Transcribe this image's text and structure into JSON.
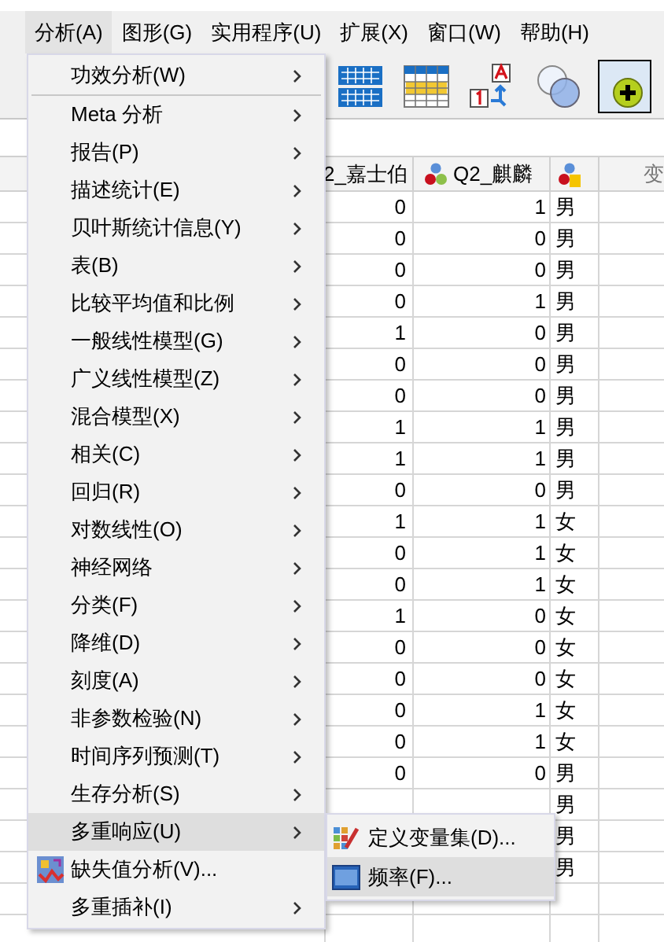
{
  "menubar": [
    {
      "label": "分析(A)",
      "selected": true
    },
    {
      "label": "图形(G)",
      "selected": false
    },
    {
      "label": "实用程序(U)",
      "selected": false
    },
    {
      "label": "扩展(X)",
      "selected": false
    },
    {
      "label": "窗口(W)",
      "selected": false
    },
    {
      "label": "帮助(H)",
      "selected": false
    }
  ],
  "toolbar": [
    {
      "kind": "grid",
      "on": false
    },
    {
      "kind": "grid-yellow",
      "on": false
    },
    {
      "kind": "value-labels",
      "on": false
    },
    {
      "kind": "sets",
      "on": false
    },
    {
      "kind": "add",
      "on": true
    }
  ],
  "table": {
    "columns": [
      "2_嘉士伯",
      "Q2_麒麟",
      "",
      "变"
    ],
    "rows": [
      {
        "c1": "0",
        "c2": "1",
        "c3": "男"
      },
      {
        "c1": "0",
        "c2": "0",
        "c3": "男"
      },
      {
        "c1": "0",
        "c2": "0",
        "c3": "男"
      },
      {
        "c1": "0",
        "c2": "1",
        "c3": "男"
      },
      {
        "c1": "1",
        "c2": "0",
        "c3": "男"
      },
      {
        "c1": "0",
        "c2": "0",
        "c3": "男"
      },
      {
        "c1": "0",
        "c2": "0",
        "c3": "男"
      },
      {
        "c1": "1",
        "c2": "1",
        "c3": "男"
      },
      {
        "c1": "1",
        "c2": "1",
        "c3": "男"
      },
      {
        "c1": "0",
        "c2": "0",
        "c3": "男"
      },
      {
        "c1": "1",
        "c2": "1",
        "c3": "女"
      },
      {
        "c1": "0",
        "c2": "1",
        "c3": "女"
      },
      {
        "c1": "0",
        "c2": "1",
        "c3": "女"
      },
      {
        "c1": "1",
        "c2": "0",
        "c3": "女"
      },
      {
        "c1": "0",
        "c2": "0",
        "c3": "女"
      },
      {
        "c1": "0",
        "c2": "0",
        "c3": "女"
      },
      {
        "c1": "0",
        "c2": "1",
        "c3": "女"
      },
      {
        "c1": "0",
        "c2": "1",
        "c3": "女"
      },
      {
        "c1": "0",
        "c2": "0",
        "c3": "男"
      },
      {
        "c3": "男"
      },
      {
        "c3": "男"
      },
      {
        "c3": "男"
      }
    ]
  },
  "menu": {
    "items": [
      {
        "label": "功效分析(W)",
        "submenu": true,
        "selected": false,
        "separator_after": true
      },
      {
        "label": "Meta 分析",
        "submenu": true,
        "selected": false
      },
      {
        "label": "报告(P)",
        "submenu": true,
        "selected": false
      },
      {
        "label": "描述统计(E)",
        "submenu": true,
        "selected": false
      },
      {
        "label": "贝叶斯统计信息(Y)",
        "submenu": true,
        "selected": false
      },
      {
        "label": "表(B)",
        "submenu": true,
        "selected": false
      },
      {
        "label": "比较平均值和比例",
        "submenu": true,
        "selected": false
      },
      {
        "label": "一般线性模型(G)",
        "submenu": true,
        "selected": false
      },
      {
        "label": "广义线性模型(Z)",
        "submenu": true,
        "selected": false
      },
      {
        "label": "混合模型(X)",
        "submenu": true,
        "selected": false
      },
      {
        "label": "相关(C)",
        "submenu": true,
        "selected": false
      },
      {
        "label": "回归(R)",
        "submenu": true,
        "selected": false
      },
      {
        "label": "对数线性(O)",
        "submenu": true,
        "selected": false
      },
      {
        "label": "神经网络",
        "submenu": true,
        "selected": false
      },
      {
        "label": "分类(F)",
        "submenu": true,
        "selected": false
      },
      {
        "label": "降维(D)",
        "submenu": true,
        "selected": false
      },
      {
        "label": "刻度(A)",
        "submenu": true,
        "selected": false
      },
      {
        "label": "非参数检验(N)",
        "submenu": true,
        "selected": false
      },
      {
        "label": "时间序列预测(T)",
        "submenu": true,
        "selected": false
      },
      {
        "label": "生存分析(S)",
        "submenu": true,
        "selected": false
      },
      {
        "label": "多重响应(U)",
        "submenu": true,
        "selected": true,
        "children": [
          {
            "label": "定义变量集(D)...",
            "kind": "sets",
            "selected": false
          },
          {
            "label": "频率(F)...",
            "kind": "numbers",
            "selected": true
          }
        ]
      },
      {
        "label": "缺失值分析(V)...",
        "submenu": false,
        "kind": "missing",
        "selected": false
      },
      {
        "label": "多重插补(I)",
        "submenu": true,
        "selected": false
      }
    ]
  }
}
